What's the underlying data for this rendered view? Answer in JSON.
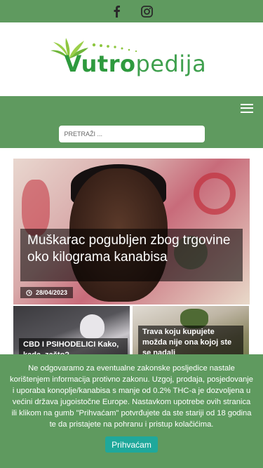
{
  "social": {
    "icons": [
      "facebook-icon",
      "instagram-icon"
    ]
  },
  "logo": {
    "part1": "Vutro",
    "part2": "pedija",
    "brand_color": "#2e9a3e"
  },
  "nav": {
    "menu_icon": "hamburger-icon",
    "background": "#5f9a5f"
  },
  "search": {
    "placeholder": "PRETRAŽI ..."
  },
  "featured": {
    "title": "Muškarac pogubljen zbog trgovine oko kilograma kanabisa",
    "date": "28/04/2023"
  },
  "cards": [
    {
      "caption": "CBD I PSIHODELICI Kako, kada, zašto?"
    },
    {
      "caption": "Trava koju kupujete možda nije ona kojoj ste se nadali"
    }
  ],
  "cookie": {
    "text": "Ne odgovaramo za eventualne zakonske posljedice nastale korištenjem informacija protivno zakonu. Uzgoj, prodaja, posjedovanje i uporaba konoplje/kanabisa s manje od 0.2% THC-a je dozvoljena u većini država jugoistočne Europe. Nastavkom upotrebe ovih stranica ili klikom na gumb \"Prihvaćam\" potvrđujete da ste stariji od 18 godina te da pristajete na pohranu i pristup kolačićima.",
    "accept_label": "Prihvaćam",
    "accent": "#1fa89b"
  }
}
